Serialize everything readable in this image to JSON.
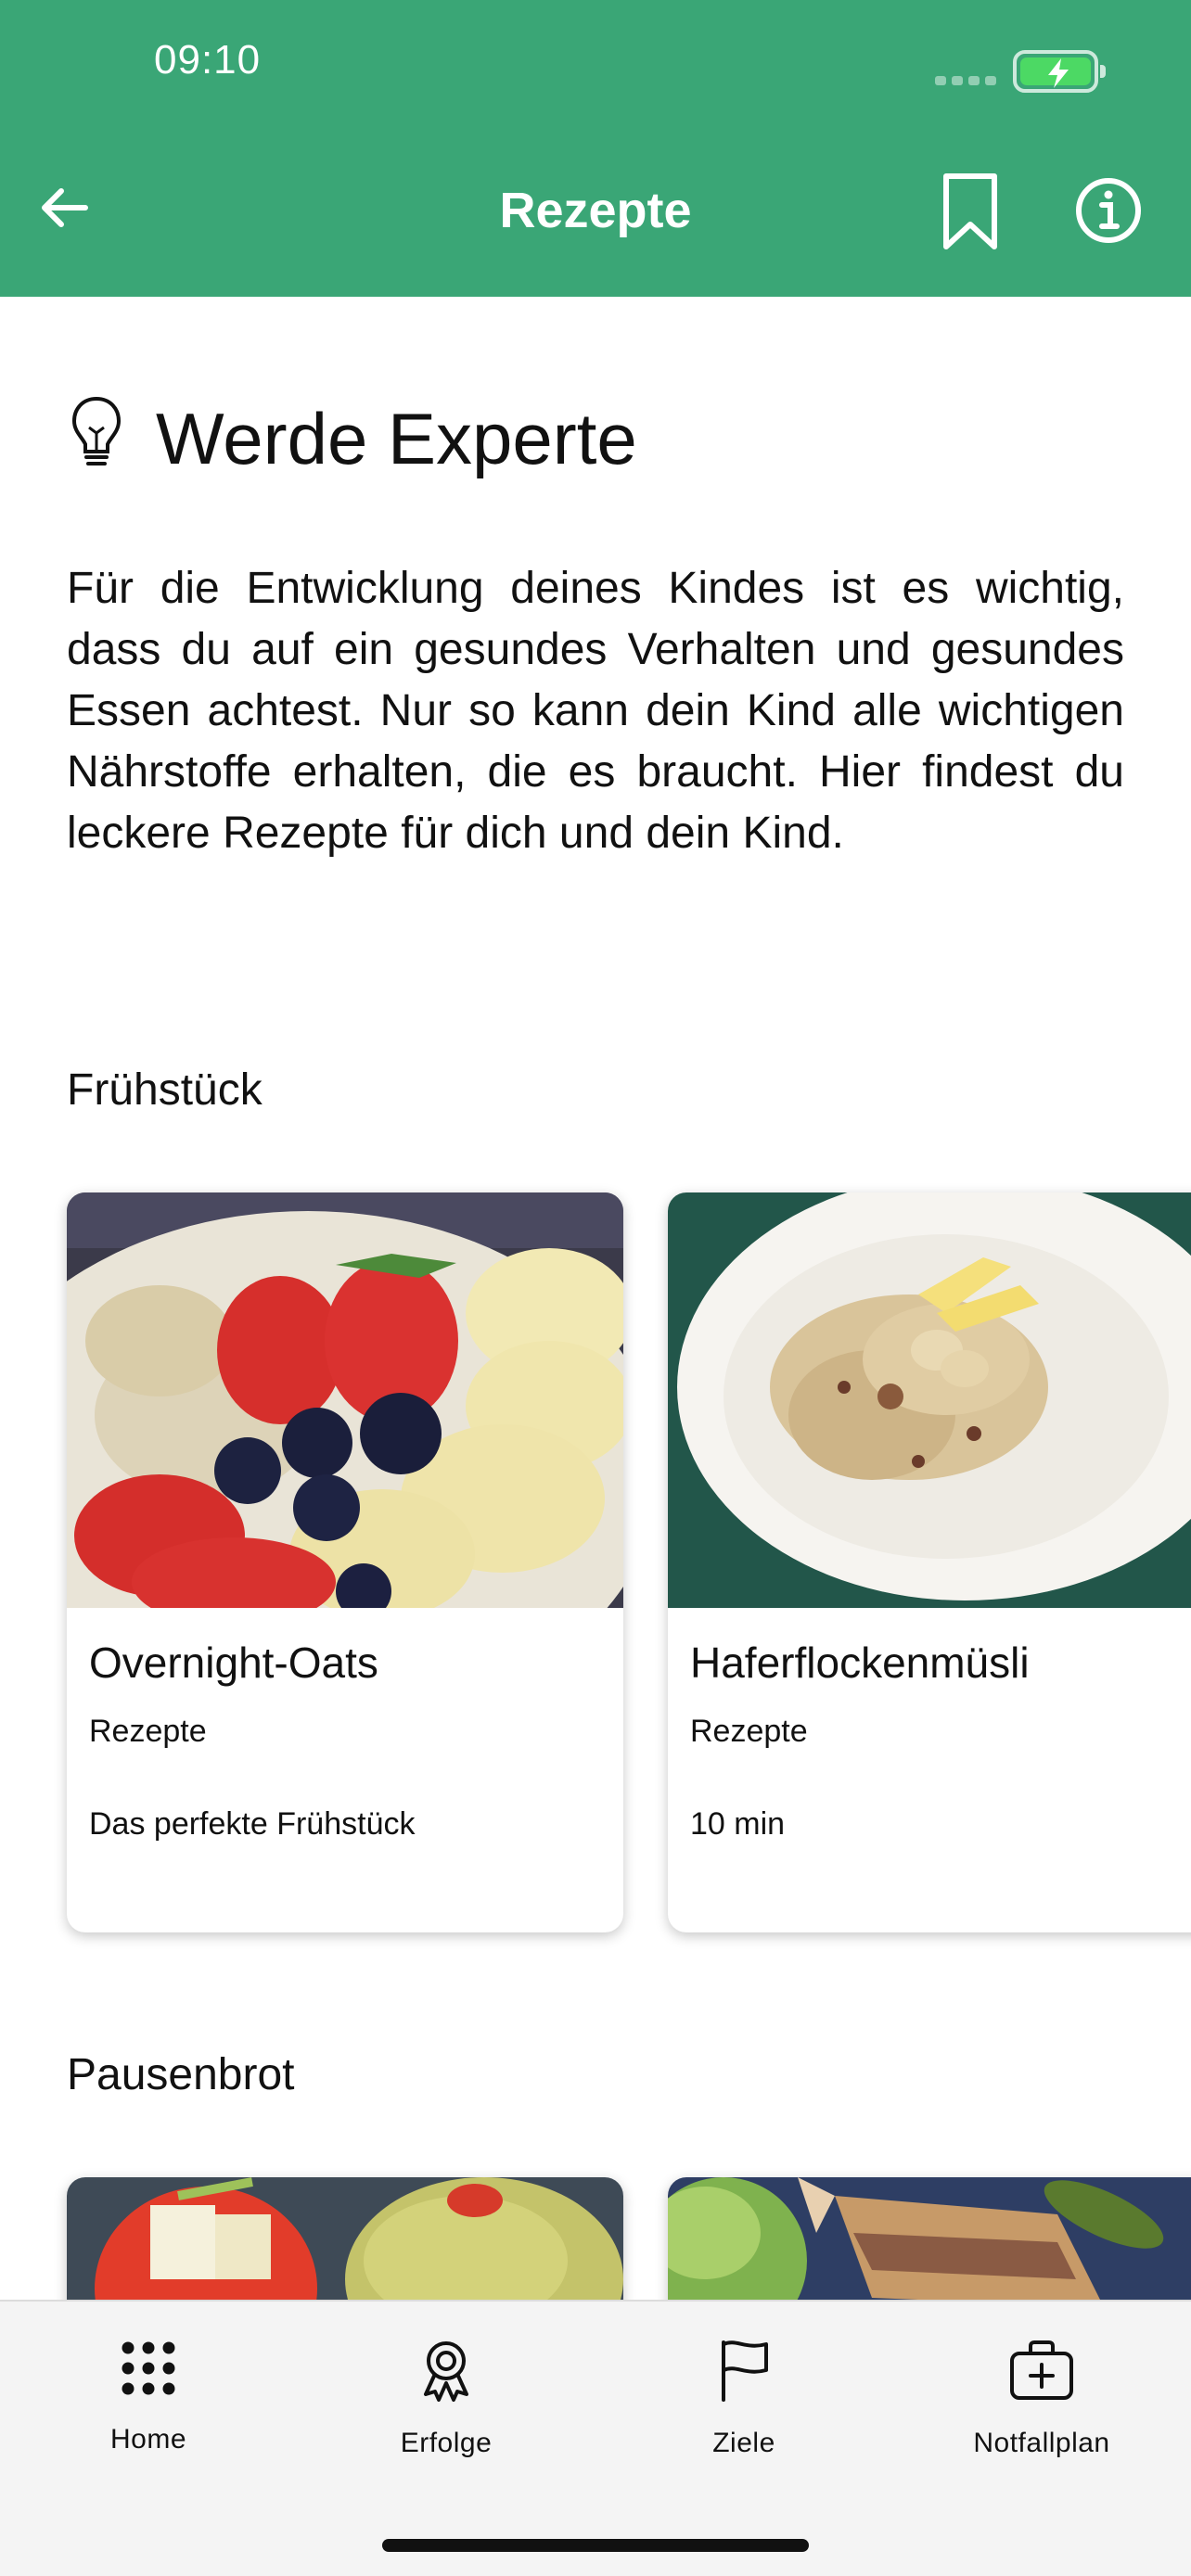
{
  "status_bar": {
    "time": "09:10",
    "battery_state": "charging"
  },
  "nav": {
    "title": "Rezepte",
    "back_icon": "arrow-left-icon",
    "bookmark_icon": "bookmark-icon",
    "info_icon": "info-icon"
  },
  "hero": {
    "icon": "lightbulb-icon",
    "title": "Werde Experte",
    "text": "Für die Entwicklung deines Kindes ist es wichtig, dass du auf ein gesundes Verhalten und gesundes Essen achtest. Nur so kann dein Kind alle wichtigen Nährstoffe erhalten, die es braucht. Hier findest du leckere Rezepte für dich und dein Kind."
  },
  "sections": [
    {
      "title": "Frühstück",
      "cards": [
        {
          "title": "Overnight-Oats",
          "category": "Rezepte",
          "detail": "Das perfekte Frühstück"
        },
        {
          "title": "Haferflockenmüsli",
          "category": "Rezepte",
          "detail": "10 min"
        }
      ]
    },
    {
      "title": "Pausenbrot"
    }
  ],
  "tabs": [
    {
      "label": "Home",
      "icon": "grid-dots-icon"
    },
    {
      "label": "Erfolge",
      "icon": "award-ribbon-icon"
    },
    {
      "label": "Ziele",
      "icon": "flag-icon"
    },
    {
      "label": "Notfallplan",
      "icon": "first-aid-kit-icon"
    }
  ],
  "colors": {
    "header": "#3aa676",
    "tab_bar": "#f4f4f4",
    "battery": "#4cd964"
  }
}
